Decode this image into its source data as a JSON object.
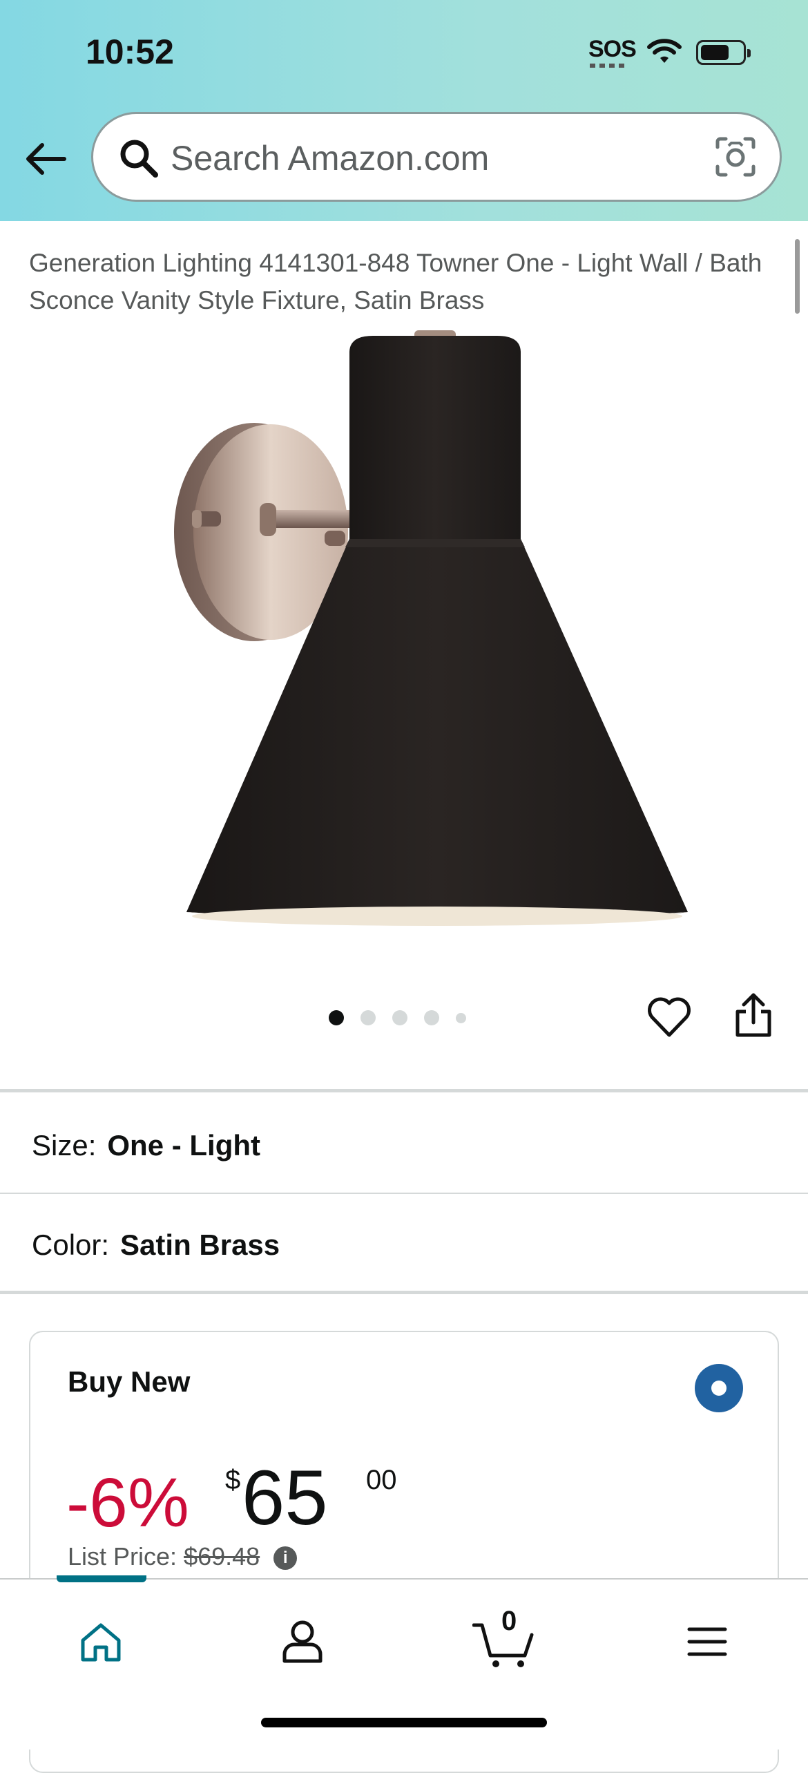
{
  "status_bar": {
    "time": "10:52",
    "sos": "SOS"
  },
  "header": {
    "search_placeholder": "Search Amazon.com",
    "icons": [
      "back-arrow-icon",
      "search-icon",
      "camera-icon"
    ],
    "colors": {
      "gradient_start": "#84d8e3",
      "gradient_end": "#a7e3d4"
    }
  },
  "product": {
    "title": "Generation Lighting 4141301-848 Towner One - Light Wall / Bath Sconce Vanity Style Fixture, Satin Brass",
    "image_count": 5,
    "active_image_index": 0
  },
  "options": {
    "size_label": "Size:",
    "size_value": "One - Light",
    "color_label": "Color:",
    "color_value": "Satin Brass"
  },
  "buy_box": {
    "title": "Buy New",
    "selected": true,
    "discount": "-6%",
    "currency": "$",
    "price_whole": "65",
    "price_fraction": "00",
    "list_price_label": "List Price:",
    "list_price_value": "$69.48",
    "info": "i",
    "colors": {
      "discount": "#cc0c39",
      "radio": "#2162a1"
    }
  },
  "bottom_nav": {
    "items": [
      "home",
      "account",
      "cart",
      "menu"
    ],
    "cart_count": "0",
    "active": "home",
    "colors": {
      "active": "#007185"
    }
  }
}
